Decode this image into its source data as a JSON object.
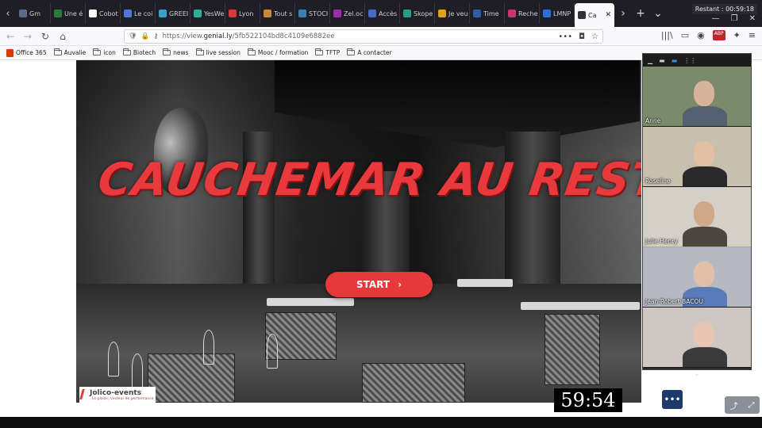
{
  "window": {
    "timer_badge": "Restant : 00:59:18"
  },
  "tabs": [
    {
      "label": "Gm",
      "color": "#5a6b8c"
    },
    {
      "label": "Une é",
      "color": "#2b7a3d"
    },
    {
      "label": "Cobot",
      "color": "#ffffff"
    },
    {
      "label": "Le coi",
      "color": "#4b7bd6"
    },
    {
      "label": "GREEI",
      "color": "#3aa0c8"
    },
    {
      "label": "YesWe",
      "color": "#2fae9b"
    },
    {
      "label": "Lyon",
      "color": "#d43c3c"
    },
    {
      "label": "Tout s",
      "color": "#c48a3a"
    },
    {
      "label": "STOCI",
      "color": "#3a7fb0"
    },
    {
      "label": "Zel.oc",
      "color": "#9b2fa8"
    },
    {
      "label": "Accès",
      "color": "#4a6cc0"
    },
    {
      "label": "Skope",
      "color": "#2a9c8f"
    },
    {
      "label": "Je veu",
      "color": "#e0a020"
    },
    {
      "label": "Time",
      "color": "#2d5fa8"
    },
    {
      "label": "Reche",
      "color": "#c33a6a"
    },
    {
      "label": "LMNP",
      "color": "#2a6fd1"
    },
    {
      "label": "Ca",
      "color": "#333333"
    }
  ],
  "tab_controls": {
    "scroll_left": "‹",
    "scroll_right": "›",
    "new_tab": "+",
    "list": "⌄"
  },
  "window_controls": {
    "minimize": "—",
    "restore": "❐",
    "close": "✕"
  },
  "nav": {
    "back": "←",
    "forward": "→",
    "reload": "↻",
    "home": "⌂",
    "url_scheme": "https://view.",
    "url_host": "genial.ly",
    "url_path": "/5fb522104bd8c4109e6882ee",
    "page_actions": "•••",
    "right_icons": [
      "|||\\",
      "▭",
      "◉",
      "ABP",
      "✦",
      "≡"
    ]
  },
  "bookmarks": [
    {
      "label": "Office 365",
      "icon": "office-icon"
    },
    {
      "label": "Auvalie",
      "icon": "folder-icon"
    },
    {
      "label": "icon",
      "icon": "folder-icon"
    },
    {
      "label": "Biotech",
      "icon": "folder-icon"
    },
    {
      "label": "news",
      "icon": "folder-icon"
    },
    {
      "label": "live session",
      "icon": "page-icon"
    },
    {
      "label": "Mooc / formation",
      "icon": "folder-icon"
    },
    {
      "label": "TFTP",
      "icon": "folder-icon"
    },
    {
      "label": "A contacter",
      "icon": "folder-icon"
    }
  ],
  "hero": {
    "title": "CAUCHEMAR AU RESTAURANT",
    "start_label": "START",
    "start_arrow": "›",
    "logo_name": "Jolico-events",
    "logo_tagline": "Le plaisir, vecteur de performance",
    "accent": "#e5393b"
  },
  "clock": "59:54",
  "more_button": "•••",
  "share_controls": {
    "share": "⤴",
    "fullscreen": "⤢"
  },
  "video_panel": {
    "toolbar": [
      "▁",
      "▬",
      "▬",
      "⋮⋮"
    ],
    "participants": [
      {
        "name": "Anne",
        "bg": "#7a8a6a",
        "skin": "#d6b39a",
        "shirt": "#556070"
      },
      {
        "name": "Roseline",
        "bg": "#c9bfae",
        "skin": "#e3c0a5",
        "shirt": "#2a2a2a"
      },
      {
        "name": "Julie Henry",
        "bg": "#d4d0c8",
        "skin": "#cfa88a",
        "shirt": "#4a4540"
      },
      {
        "name": "Jean-Robert BACOU",
        "bg": "#b7b9c2",
        "skin": "#e2bfa8",
        "shirt": "#5a7ab8"
      },
      {
        "name": "",
        "bg": "#cfc8c2",
        "skin": "#e8c5b0",
        "shirt": "#3a3a3a"
      }
    ],
    "footer": "⌄"
  }
}
